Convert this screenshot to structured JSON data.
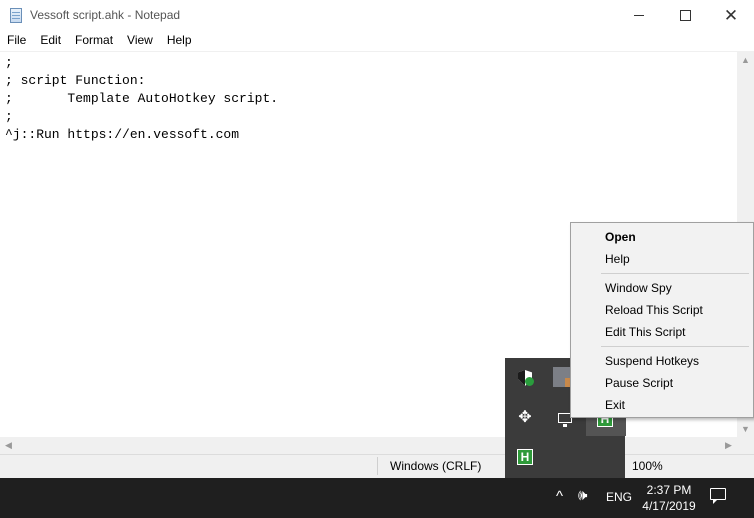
{
  "window": {
    "title": "Vessoft script.ahk - Notepad",
    "icon": "notepad-icon",
    "controls": {
      "minimize": "minimize-icon",
      "maximize": "maximize-icon",
      "close": "✕"
    }
  },
  "menubar": [
    "File",
    "Edit",
    "Format",
    "View",
    "Help"
  ],
  "editor": {
    "lines": [
      ";",
      "; script Function:",
      ";       Template AutoHotkey script.",
      ";",
      "^j::Run https://en.vessoft.com"
    ]
  },
  "statusbar": {
    "line_ending": "Windows (CRLF)",
    "zoom": "100%"
  },
  "context_menu": {
    "items": [
      {
        "label": "Open",
        "default": true
      },
      {
        "label": "Help"
      },
      {
        "label": "Window Spy"
      },
      {
        "label": "Reload This Script"
      },
      {
        "label": "Edit This Script"
      },
      {
        "label": "Suspend Hotkeys"
      },
      {
        "label": "Pause Script"
      },
      {
        "label": "Exit"
      }
    ]
  },
  "tray_flyout": {
    "icons": [
      "windows-security-icon",
      "app-tile-icon",
      "move-icon",
      "network-icon",
      "autohotkey-icon",
      "autohotkey-icon"
    ]
  },
  "taskbar": {
    "chevron": "^",
    "speaker": "🕪",
    "language": "ENG",
    "time": "2:37 PM",
    "date": "4/17/2019",
    "notification": "action-center-icon"
  }
}
